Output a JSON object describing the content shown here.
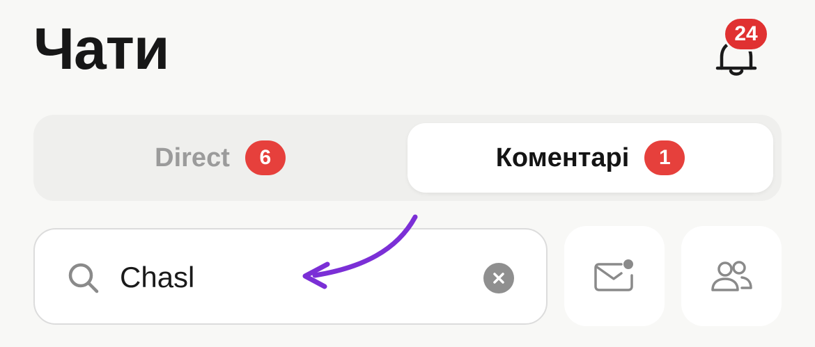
{
  "header": {
    "title": "Чати",
    "notifications_count": "24"
  },
  "tabs": [
    {
      "label": "Direct",
      "count": "6",
      "active": false
    },
    {
      "label": "Коментарі",
      "count": "1",
      "active": true
    }
  ],
  "search": {
    "value": "Chasl",
    "placeholder": ""
  },
  "actions": {
    "unread_icon": "mail-unread-icon",
    "contacts_icon": "people-icon"
  },
  "annotation": {
    "arrow_color": "#7b2fd6"
  },
  "colors": {
    "badge": "#e6403c",
    "background": "#f8f8f6",
    "accent_arrow": "#7b2fd6"
  }
}
